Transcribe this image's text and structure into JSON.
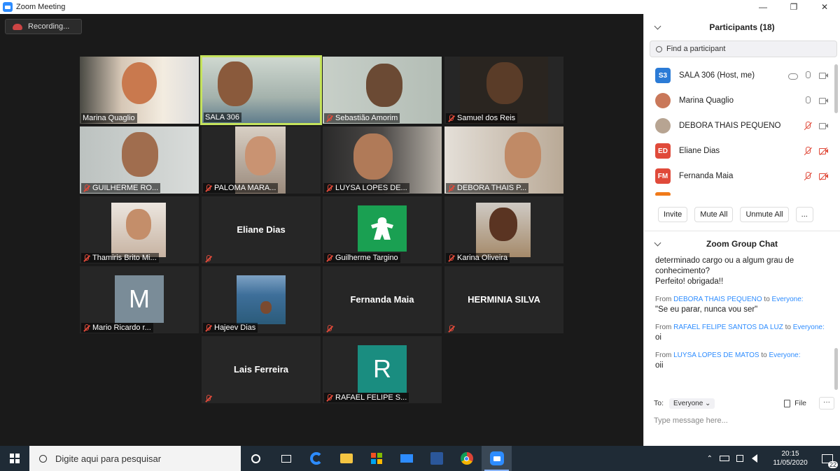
{
  "window": {
    "title": "Zoom Meeting",
    "minimize": "—",
    "maximize": "❐",
    "close": "✕"
  },
  "recording": {
    "label": "Recording..."
  },
  "tiles": [
    {
      "name": "Marina Quaglio",
      "muted": false
    },
    {
      "name": "SALA 306",
      "muted": false
    },
    {
      "name": "Sebastião Amorim",
      "muted": true
    },
    {
      "name": "Samuel dos Reis",
      "muted": true
    },
    {
      "name": "GUILHERME RO...",
      "muted": true
    },
    {
      "name": "PALOMA MARA...",
      "muted": true
    },
    {
      "name": "LUYSA LOPES DE...",
      "muted": true
    },
    {
      "name": "DEBORA THAIS P...",
      "muted": true
    },
    {
      "name": "Thamiris Brito Mi...",
      "muted": true
    },
    {
      "name": "",
      "center": "Eliane Dias",
      "muted": true
    },
    {
      "name": "Guilherme Targino",
      "muted": true
    },
    {
      "name": "Karina Oliveira",
      "muted": true
    },
    {
      "name": "Mario Ricardo r...",
      "muted": true,
      "avatar": "M"
    },
    {
      "name": "Hajeev Dias",
      "muted": true
    },
    {
      "name": "",
      "center": "Fernanda Maia",
      "muted": true
    },
    {
      "name": "",
      "center": "HERMINIA SILVA",
      "muted": true
    },
    {
      "name": "",
      "center": "Lais Ferreira",
      "muted": true
    },
    {
      "name": "RAFAEL FELIPE S...",
      "muted": true,
      "avatar": "R"
    }
  ],
  "participants": {
    "title": "Participants (18)",
    "search_placeholder": "Find a participant",
    "list": [
      {
        "initials": "S3",
        "name": "SALA 306 (Host, me)",
        "color": "#2b7bd6"
      },
      {
        "initials": "",
        "name": "Marina Quaglio",
        "color": "#c9785a"
      },
      {
        "initials": "",
        "name": "DEBORA THAIS PEQUENO",
        "color": "#b7a492"
      },
      {
        "initials": "ED",
        "name": "Eliane Dias",
        "color": "#e04a3a"
      },
      {
        "initials": "FM",
        "name": "Fernanda Maia",
        "color": "#e04a3a"
      }
    ],
    "buttons": {
      "invite": "Invite",
      "mute_all": "Mute All",
      "unmute_all": "Unmute All",
      "more": "..."
    }
  },
  "chat": {
    "title": "Zoom Group Chat",
    "lines": [
      "determinado cargo ou a algum grau de conhecimento?",
      "Perfeito! obrigada!!"
    ],
    "messages": [
      {
        "from": "DEBORA THAIS PEQUENO",
        "to": "Everyone:",
        "text": "\"Se eu parar, nunca vou ser\""
      },
      {
        "from": "RAFAEL FELIPE SANTOS DA LUZ",
        "to": "Everyone:",
        "text": "oi"
      },
      {
        "from": "LUYSA LOPES DE MATOS",
        "to": "Everyone:",
        "text": "oii"
      }
    ],
    "from_word": "From",
    "to_word": "to",
    "to_label": "To:",
    "to_value": "Everyone ⌄",
    "file_label": "File",
    "more": "···",
    "placeholder": "Type message here..."
  },
  "taskbar": {
    "search_text": "Digite aqui para pesquisar",
    "time": "20:15",
    "date": "11/05/2020",
    "notif_count": "22"
  }
}
